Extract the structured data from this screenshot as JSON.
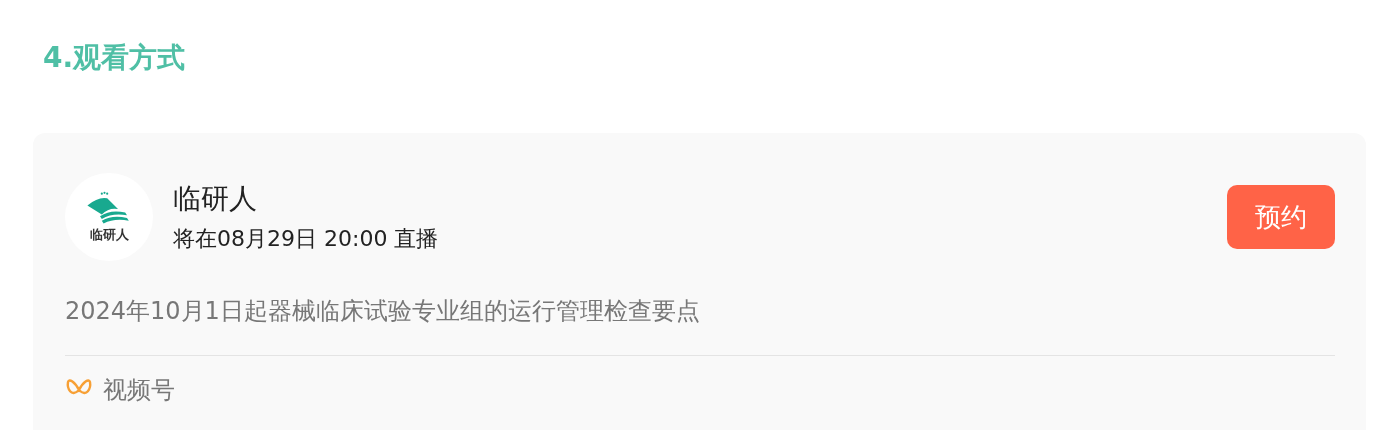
{
  "section_title": "4.观看方式",
  "live_card": {
    "avatar_text": "临研人",
    "account_name": "临研人",
    "schedule": "将在08月29日 20:00 直播",
    "button": "预约",
    "description": "2024年10月1日起器械临床试验专业组的运行管理检查要点",
    "platform": "视频号"
  }
}
